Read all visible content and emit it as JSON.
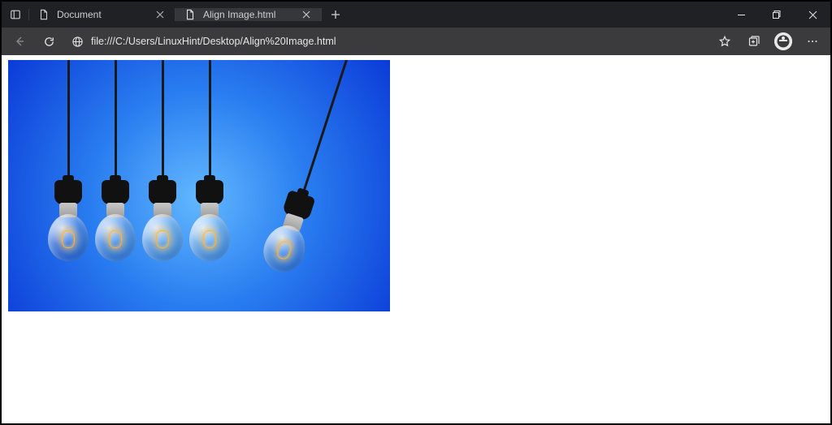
{
  "tabs": [
    {
      "title": "Document",
      "active": false
    },
    {
      "title": "Align Image.html",
      "active": true
    }
  ],
  "toolbar": {
    "url": "file:///C:/Users/LinuxHint/Desktop/Align%20Image.html"
  },
  "page": {
    "image_alt": "Hanging light bulbs"
  }
}
